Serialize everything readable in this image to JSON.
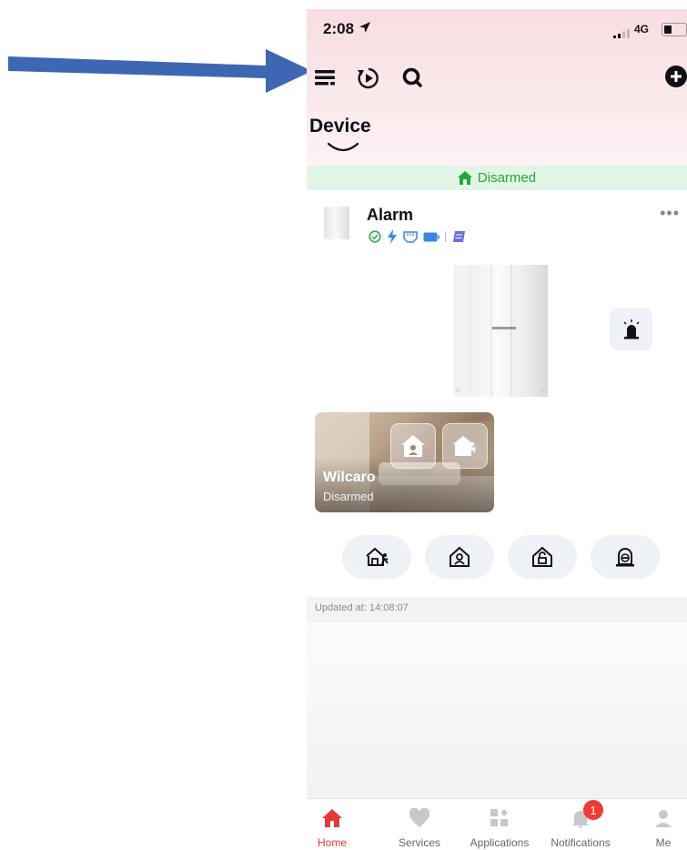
{
  "status_bar": {
    "time": "2:08",
    "network": "4G"
  },
  "header": {
    "title": "Device"
  },
  "arm_banner": {
    "label": "Disarmed",
    "color": "#21a63a"
  },
  "device": {
    "name": "Alarm",
    "status_icons": [
      "online-check-icon",
      "power-icon",
      "network-port-icon",
      "battery-icon",
      "sim-icon"
    ],
    "siren_icon": "siren-icon"
  },
  "area": {
    "name": "Wilcaro",
    "status": "Disarmed"
  },
  "arm_modes": [
    "away-arm-icon",
    "stay-arm-icon",
    "disarm-icon",
    "clear-alarm-icon"
  ],
  "updated": {
    "label": "Updated at: 14:08:07"
  },
  "tabbar": {
    "items": [
      {
        "label": "Home",
        "icon": "home-icon",
        "active": true
      },
      {
        "label": "Services",
        "icon": "heart-icon"
      },
      {
        "label": "Applications",
        "icon": "applications-icon"
      },
      {
        "label": "Notifications",
        "icon": "bell-icon",
        "badge": "1"
      },
      {
        "label": "Me",
        "icon": "user-icon"
      }
    ]
  },
  "colors": {
    "accent": "#e23b35",
    "annotation_arrow": "#3d67b3",
    "armed_green": "#21a63a"
  }
}
